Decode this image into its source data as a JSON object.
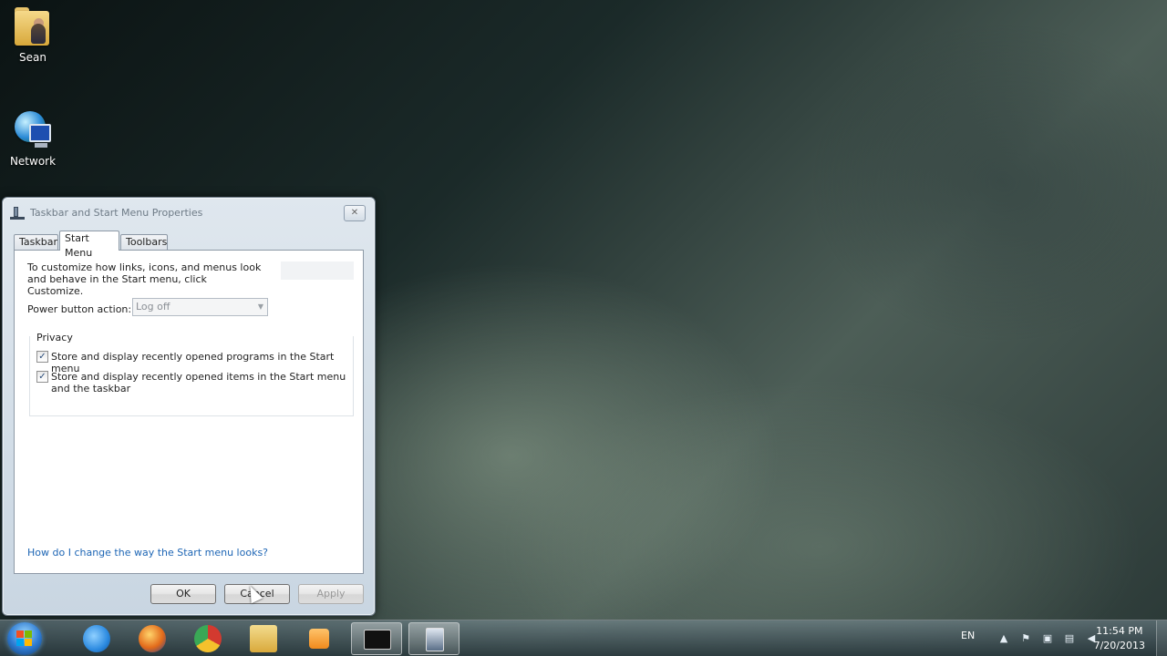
{
  "desktop": {
    "icons": [
      {
        "label": "Sean",
        "icon": "user-folder-icon"
      },
      {
        "label": "Network",
        "icon": "network-icon"
      }
    ]
  },
  "dialog": {
    "title": "Taskbar and Start Menu Properties",
    "close_label": "✕",
    "tabs": [
      {
        "label": "Taskbar",
        "active": false
      },
      {
        "label": "Start Menu",
        "active": true
      },
      {
        "label": "Toolbars",
        "active": false
      }
    ],
    "description": "To customize how links, icons, and menus look and behave in the Start menu, click Customize.",
    "power_button_label": "Power button action:",
    "power_button_value": "Log off",
    "privacy_title": "Privacy",
    "checkboxes": [
      {
        "label": "Store and display recently opened programs in the Start menu",
        "checked": true
      },
      {
        "label": "Store and display recently opened items in the Start menu and the taskbar",
        "checked": true
      }
    ],
    "help_link": "How do I change the way the Start menu looks?",
    "buttons": {
      "ok": "OK",
      "cancel": "Cancel",
      "apply": "Apply"
    }
  },
  "taskbar": {
    "pinned": [
      {
        "name": "internet-explorer-icon",
        "color": "#2c8ae0"
      },
      {
        "name": "firefox-icon",
        "color": "#e26a1a"
      },
      {
        "name": "chrome-icon",
        "color": "#d33a2f"
      },
      {
        "name": "file-explorer-icon",
        "color": "#e4c36a"
      },
      {
        "name": "media-player-icon",
        "color": "#f08a1c"
      },
      {
        "name": "command-prompt-icon",
        "color": "#111111"
      },
      {
        "name": "taskbar-properties-icon",
        "color": "#5a6f88"
      }
    ],
    "tray": {
      "language": "EN",
      "time": "11:54 PM",
      "date": "7/20/2013"
    }
  }
}
